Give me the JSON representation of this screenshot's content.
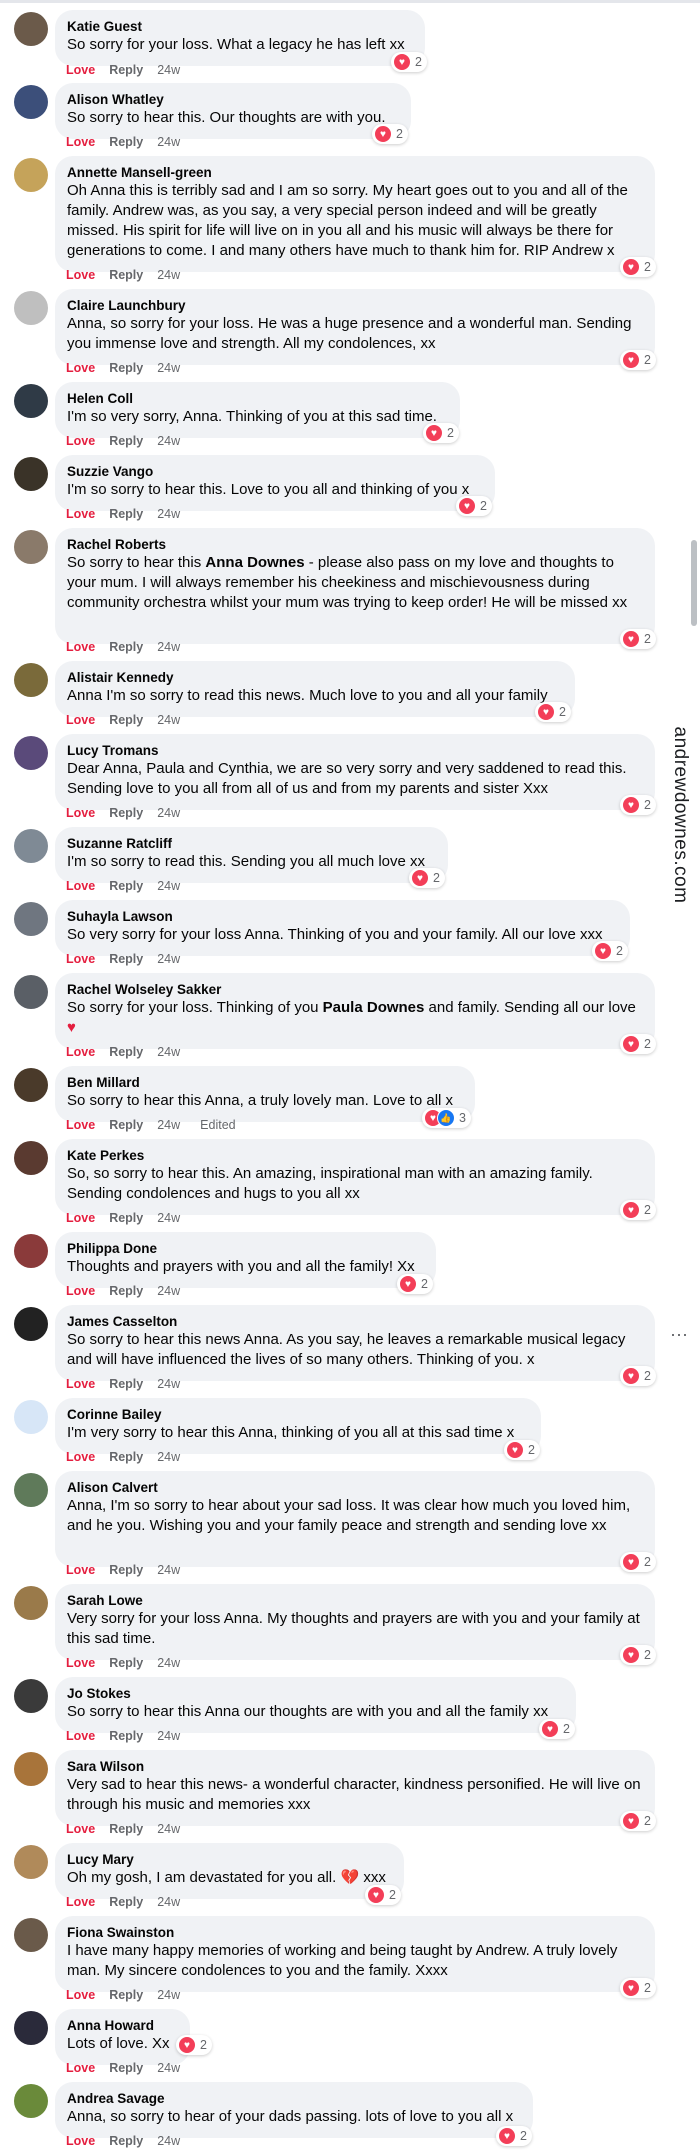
{
  "page": {
    "side_label": "andrewdownes.com",
    "more_icon": "more-horizontal-icon",
    "colors": {
      "love": "#e41e3f",
      "bubble": "#f0f2f5",
      "heart_reaction": "#f33e58",
      "like_reaction": "#1877f2",
      "meta_text": "#65676b"
    }
  },
  "actions": {
    "love": "Love",
    "reply": "Reply",
    "edited": "Edited"
  },
  "comments": [
    {
      "author": "Katie Guest",
      "text": "So sorry for your loss. What a legacy he has left xx",
      "time": "24w",
      "reaction_count": "2",
      "avatar_color": "#6b5a4a"
    },
    {
      "author": "Alison Whatley",
      "text": "So sorry to hear this. Our thoughts are with you.",
      "time": "24w",
      "reaction_count": "2",
      "avatar_color": "#3c4f7a"
    },
    {
      "author": "Annette Mansell-green",
      "text": "Oh Anna this is terribly sad and I am so sorry. My heart goes out to you and all of the family. Andrew was, as you say, a very special person indeed and will be greatly missed. His spirit for life will live on in you all and his music will always be there for generations to come. I and many others have much to thank him for. RIP Andrew x",
      "time": "24w",
      "reaction_count": "2",
      "avatar_color": "#c5a35a"
    },
    {
      "author": "Claire Launchbury",
      "text": "Anna, so sorry for your loss. He was a huge presence and a wonderful man. Sending you immense love and strength. All my condolences, xx",
      "time": "24w",
      "reaction_count": "2",
      "avatar_color": "#bfbfbf"
    },
    {
      "author": "Helen Coll",
      "text": "I'm so very sorry, Anna. Thinking of you at this sad time.",
      "time": "24w",
      "reaction_count": "2",
      "avatar_color": "#2f3a46"
    },
    {
      "author": "Suzzie Vango",
      "text": "I'm so sorry to hear this. Love to you all and thinking of you x",
      "time": "24w",
      "reaction_count": "2",
      "avatar_color": "#3a3328"
    },
    {
      "author": "Rachel Roberts",
      "text_pre": "So sorry to hear this ",
      "text_bold": "Anna Downes",
      "text_post": " - please also pass on my love and thoughts to your mum. I will always remember his cheekiness and mischievousness during community orchestra whilst your mum was trying to keep order! He will be missed xx",
      "time": "24w",
      "reaction_count": "2",
      "avatar_color": "#8a7a6a"
    },
    {
      "author": "Alistair Kennedy",
      "text": "Anna I'm so sorry to read this news. Much love to you and all your family",
      "time": "24w",
      "reaction_count": "2",
      "avatar_color": "#7a6a3a"
    },
    {
      "author": "Lucy Tromans",
      "text": "Dear Anna, Paula and Cynthia, we are so very sorry and very saddened to read this. Sending love to you all from all of us and from my parents and sister Xxx",
      "time": "24w",
      "reaction_count": "2",
      "avatar_color": "#5a4a7a"
    },
    {
      "author": "Suzanne Ratcliff",
      "text": "I'm so sorry to read this. Sending you all much love xx",
      "time": "24w",
      "reaction_count": "2",
      "avatar_color": "#7f8a95"
    },
    {
      "author": "Suhayla Lawson",
      "text": "So very sorry for your loss Anna. Thinking of you and your family. All our love xxx",
      "time": "24w",
      "reaction_count": "2",
      "avatar_color": "#6f7680"
    },
    {
      "author": "Rachel Wolseley Sakker",
      "text_pre": "So sorry for your loss. Thinking of you ",
      "text_bold": "Paula Downes",
      "text_post": " and family. Sending all our love ",
      "text_emoji": "♥",
      "time": "24w",
      "reaction_count": "2",
      "avatar_color": "#5a5f66"
    },
    {
      "author": "Ben Millard",
      "text": "So sorry to hear this Anna, a truly lovely man. Love to all x",
      "time": "24w",
      "reaction_count": "3",
      "avatar_color": "#4a3a2a",
      "edited": true,
      "has_like": true
    },
    {
      "author": "Kate Perkes",
      "text": "So, so sorry to hear this. An amazing, inspirational man with an amazing family. Sending condolences and hugs to you all xx",
      "time": "24w",
      "reaction_count": "2",
      "avatar_color": "#5a3a30"
    },
    {
      "author": "Philippa Done",
      "text": "Thoughts and prayers with you and all the family! Xx",
      "time": "24w",
      "reaction_count": "2",
      "avatar_color": "#8a3a3a"
    },
    {
      "author": "James Casselton",
      "text": "So sorry to hear this news Anna. As you say, he leaves a remarkable musical legacy and will have influenced the lives of so many others. Thinking of you. x",
      "time": "24w",
      "reaction_count": "2",
      "avatar_color": "#222222"
    },
    {
      "author": "Corinne Bailey",
      "text": "I'm very sorry to hear this Anna, thinking of you all at this sad time x",
      "time": "24w",
      "reaction_count": "2",
      "avatar_color": "#d7e6f7"
    },
    {
      "author": "Alison Calvert",
      "text": "Anna, I'm so sorry to hear about your sad loss. It was clear how much you loved him, and he you. Wishing you and your family peace and strength and sending love xx",
      "time": "24w",
      "reaction_count": "2",
      "avatar_color": "#5f7a5a"
    },
    {
      "author": "Sarah Lowe",
      "text": "Very sorry for your loss Anna. My thoughts and prayers are with you and your family at this sad time.",
      "time": "24w",
      "reaction_count": "2",
      "avatar_color": "#9a7a4a"
    },
    {
      "author": "Jo Stokes",
      "text": "So sorry to hear this Anna our thoughts are with you and all the family xx",
      "time": "24w",
      "reaction_count": "2",
      "avatar_color": "#3a3a3a"
    },
    {
      "author": "Sara Wilson",
      "text": "Very sad to hear this news- a wonderful character, kindness personified. He will live on through his music and memories xxx",
      "time": "24w",
      "reaction_count": "2",
      "avatar_color": "#a8743a"
    },
    {
      "author": "Lucy Mary",
      "text_pre": "Oh my gosh, I am devastated for you all. ",
      "text_emoji": "💔",
      "text_post": " xxx",
      "time": "24w",
      "reaction_count": "2",
      "avatar_color": "#b08a5a"
    },
    {
      "author": "Fiona Swainston",
      "text": "I have many happy memories of working and being taught by Andrew. A truly lovely man. My sincere condolences to you and the family. Xxxx",
      "time": "24w",
      "reaction_count": "2",
      "avatar_color": "#6a5a4a"
    },
    {
      "author": "Anna Howard",
      "text": "Lots of love. Xx",
      "time": "24w",
      "reaction_count": "2",
      "avatar_color": "#2a2a3a"
    },
    {
      "author": "Andrea Savage",
      "text": "Anna, so sorry to hear of your dads passing. lots of love to you all x",
      "time": "24w",
      "reaction_count": "2",
      "avatar_color": "#6a8a3a"
    }
  ]
}
